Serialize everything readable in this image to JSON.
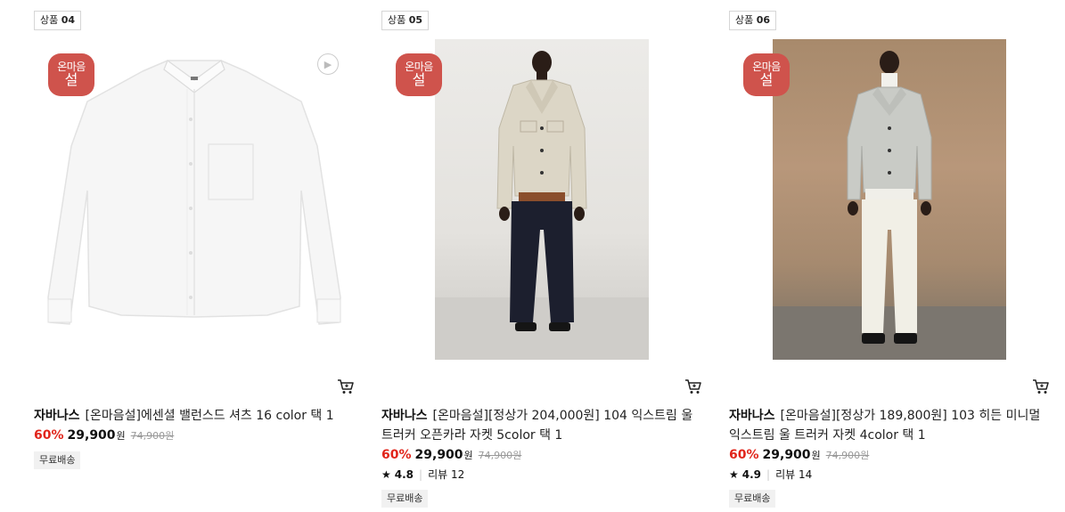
{
  "colors": {
    "badge": "#cf534c",
    "discount": "#e1251b"
  },
  "products": [
    {
      "rank_label": "상품",
      "rank_no": "04",
      "badge_line1": "온마음",
      "badge_line2": "설",
      "brand": "자바나스",
      "name": "[온마음설]에센셜 밸런스드 셔츠 16 color 택 1",
      "discount": "60%",
      "price": "29,900",
      "price_unit": "원",
      "original_price": "74,900",
      "original_unit": "원",
      "shipping": "무료배송",
      "icons": [
        "play-icon",
        "cart-icon"
      ]
    },
    {
      "rank_label": "상품",
      "rank_no": "05",
      "badge_line1": "온마음",
      "badge_line2": "설",
      "brand": "자바나스",
      "name": "[온마음설][정상가 204,000원] 104 익스트림 울 트러커 오픈카라 자켓 5color 택 1",
      "discount": "60%",
      "price": "29,900",
      "price_unit": "원",
      "original_price": "74,900",
      "original_unit": "원",
      "rating": "4.8",
      "review_label": "리뷰",
      "review_count": "12",
      "shipping": "무료배송",
      "icons": [
        "star-icon",
        "cart-icon"
      ]
    },
    {
      "rank_label": "상품",
      "rank_no": "06",
      "badge_line1": "온마음",
      "badge_line2": "설",
      "brand": "자바나스",
      "name": "[온마음설][정상가 189,800원] 103 히든 미니멀 익스트림 울 트러커 자켓 4color 택 1",
      "discount": "60%",
      "price": "29,900",
      "price_unit": "원",
      "original_price": "74,900",
      "original_unit": "원",
      "rating": "4.9",
      "review_label": "리뷰",
      "review_count": "14",
      "shipping": "무료배송",
      "icons": [
        "star-icon",
        "cart-icon"
      ]
    }
  ]
}
